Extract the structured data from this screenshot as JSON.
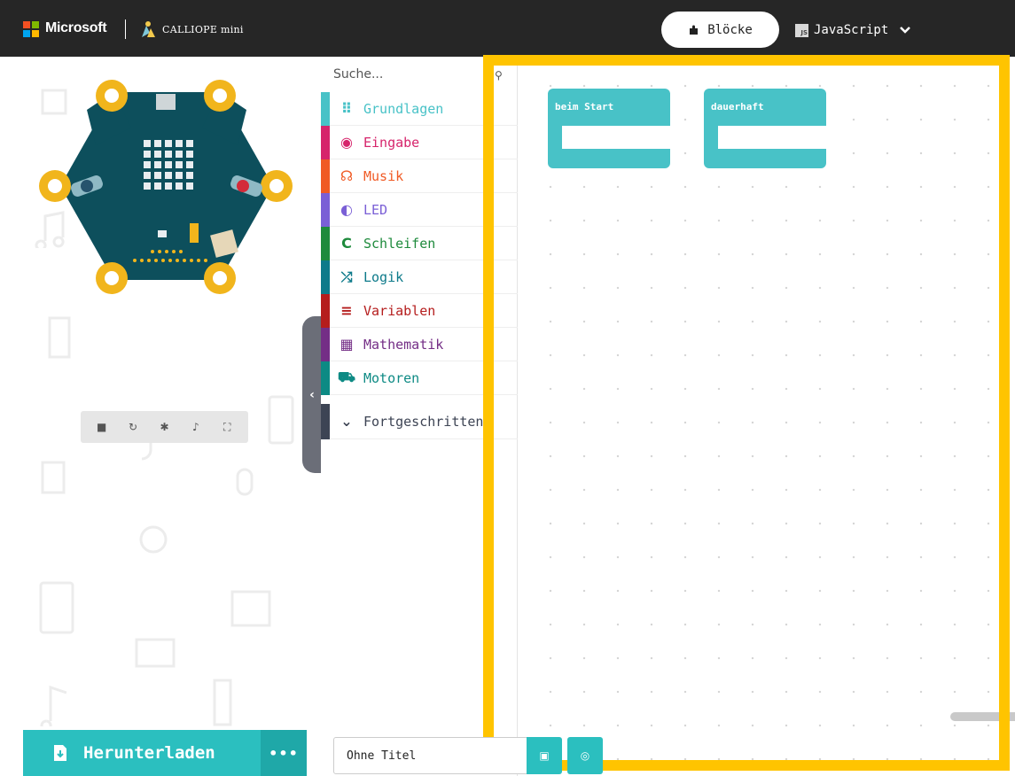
{
  "header": {
    "brand": "Microsoft",
    "product": "CALLIOPE mini",
    "blocks_tab": "Blöcke",
    "js_tab": "JavaScript",
    "js_badge": "JS"
  },
  "toolbox": {
    "search_placeholder": "Suche...",
    "categories": [
      {
        "label": "Grundlagen",
        "color": "#48c2c7",
        "icon": "grid-icon"
      },
      {
        "label": "Eingabe",
        "color": "#d6246b",
        "icon": "target-icon"
      },
      {
        "label": "Musik",
        "color": "#f05a24",
        "icon": "headphones-icon"
      },
      {
        "label": "LED",
        "color": "#7a5fd6",
        "icon": "toggle-icon"
      },
      {
        "label": "Schleifen",
        "color": "#1e8a3c",
        "icon": "refresh-icon"
      },
      {
        "label": "Logik",
        "color": "#0d7a8a",
        "icon": "shuffle-icon"
      },
      {
        "label": "Variablen",
        "color": "#b51d1d",
        "icon": "list-icon"
      },
      {
        "label": "Mathematik",
        "color": "#742e86",
        "icon": "calculator-icon"
      },
      {
        "label": "Motoren",
        "color": "#0d8a84",
        "icon": "car-icon"
      },
      {
        "label": "Fortgeschritten",
        "color": "#3d4454",
        "icon": "chevron-down-icon"
      }
    ]
  },
  "workspace": {
    "blocks": [
      {
        "title": "beim Start",
        "color": "#48c2c7"
      },
      {
        "title": "dauerhaft",
        "color": "#48c2c7"
      }
    ]
  },
  "footer": {
    "download_label": "Herunterladen",
    "more_label": "•••",
    "project_title": "Ohne Titel"
  },
  "colors": {
    "highlight": "#ffc400",
    "download": "#2bbfbf",
    "header_bg": "#262626"
  }
}
